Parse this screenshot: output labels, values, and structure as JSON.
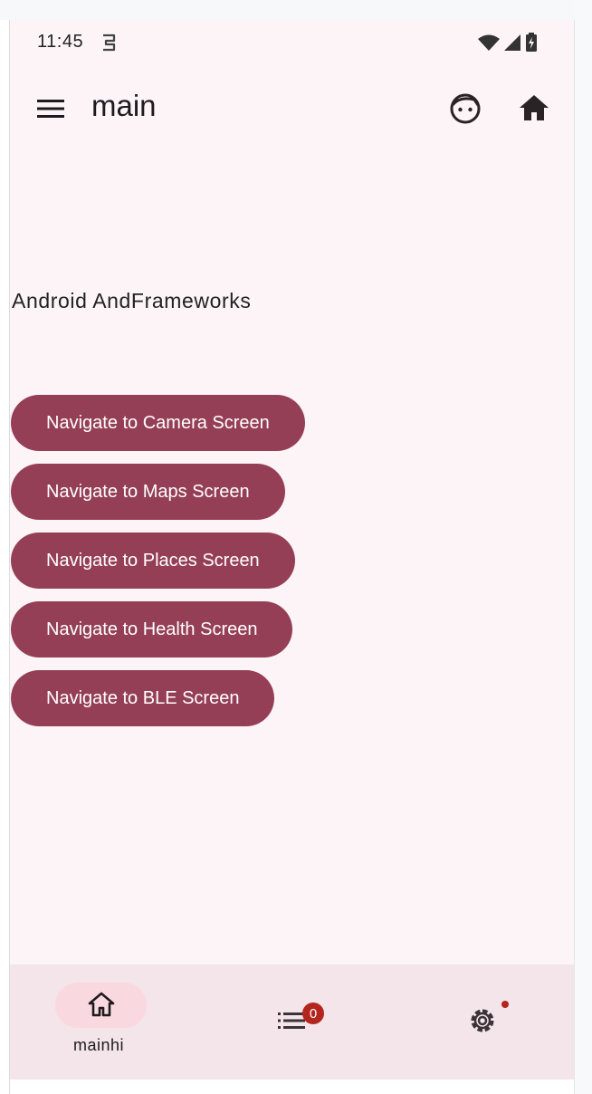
{
  "status_bar": {
    "time": "11:45"
  },
  "app_bar": {
    "title": "main",
    "menu_icon": "menu-icon",
    "face_icon": "face-icon",
    "home_icon": "home-icon"
  },
  "content": {
    "headline": "Android AndFrameworks",
    "buttons": [
      {
        "label": "Navigate to Camera Screen"
      },
      {
        "label": "Navigate to Maps Screen"
      },
      {
        "label": "Navigate to Places Screen"
      },
      {
        "label": "Navigate to Health Screen"
      },
      {
        "label": "Navigate to BLE Screen"
      }
    ]
  },
  "bottom_nav": {
    "items": [
      {
        "label": "mainhi",
        "icon": "home-icon",
        "selected": true
      },
      {
        "label": "",
        "icon": "list-icon",
        "badge": "0"
      },
      {
        "label": "",
        "icon": "settings-icon",
        "dot": true
      }
    ]
  },
  "colors": {
    "button": "#953f57",
    "background": "#fcf4f7",
    "bottom_nav": "#f3e5e9",
    "selected_pill": "#f9d9df",
    "badge": "#b3261e"
  }
}
